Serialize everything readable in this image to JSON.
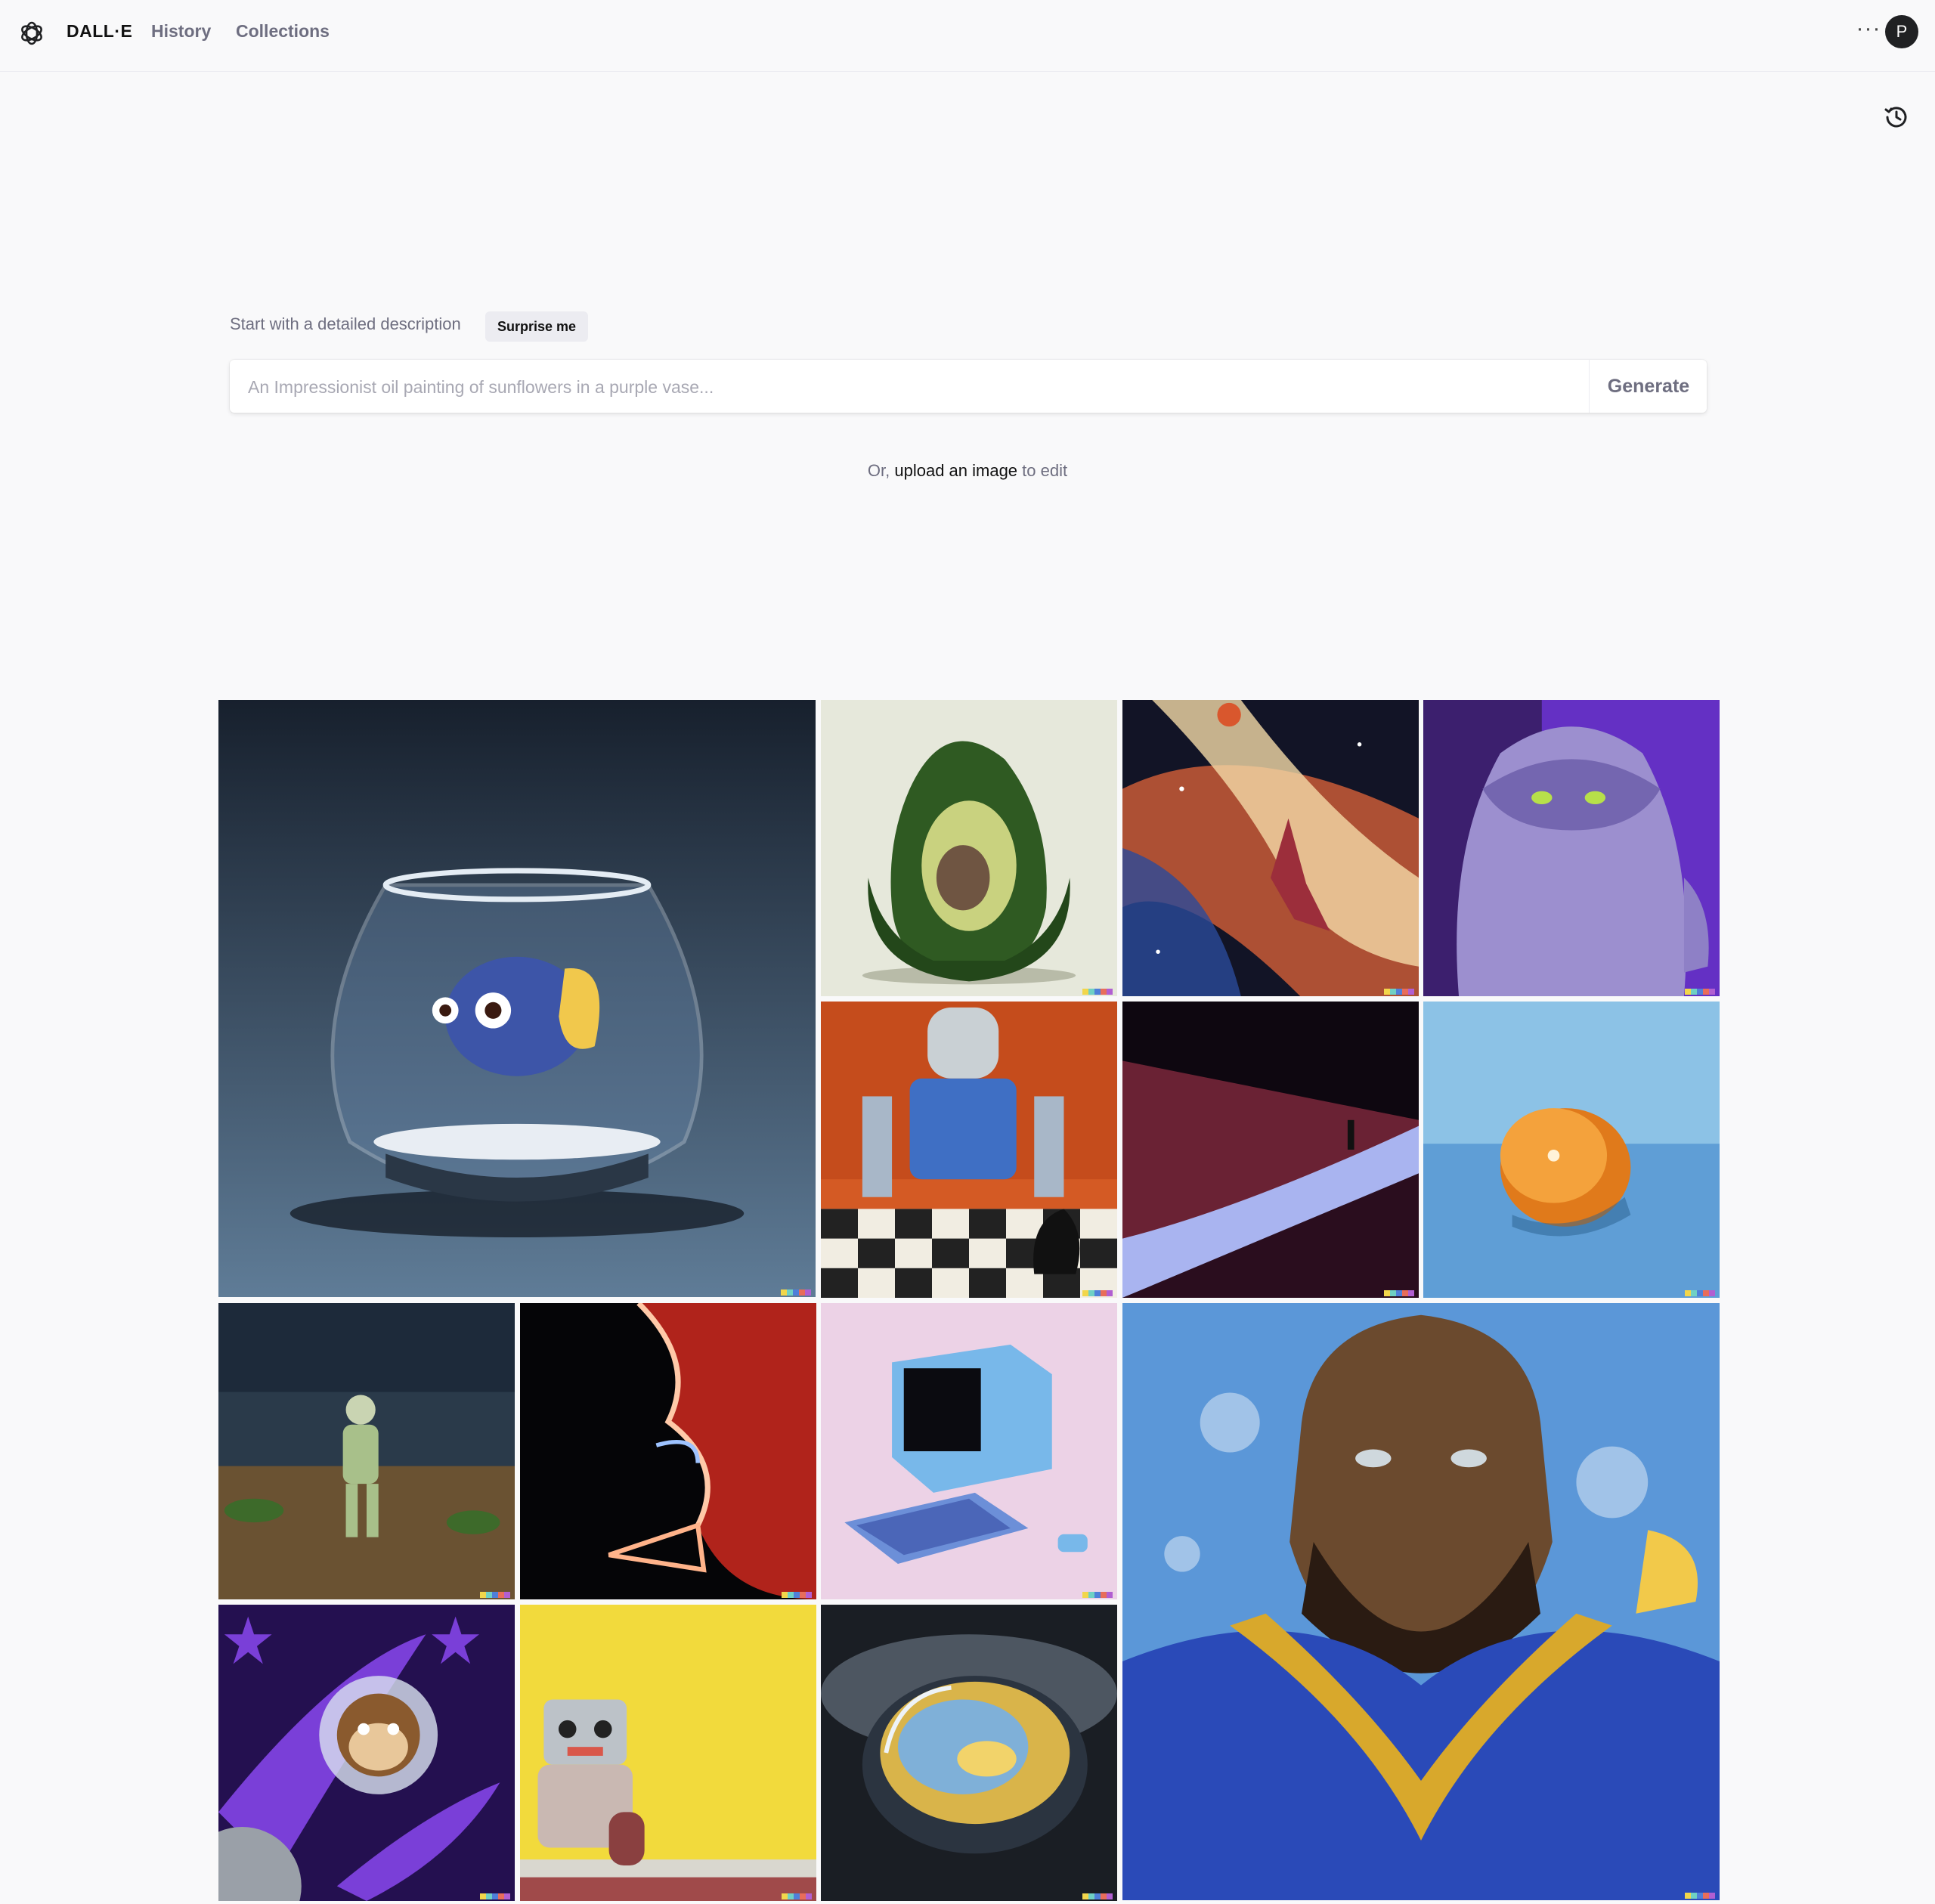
{
  "nav": {
    "brand": "DALL·E",
    "history": "History",
    "collections": "Collections",
    "more": "···",
    "avatar_initial": "P"
  },
  "prompt": {
    "label": "Start with a detailed description",
    "surprise_label": "Surprise me",
    "placeholder": "An Impressionist oil painting of sunflowers in a purple vase...",
    "value": "",
    "generate_label": "Generate"
  },
  "upload": {
    "prefix": "Or,",
    "link": "upload an image",
    "suffix": "to edit"
  },
  "gallery": {
    "tiles": [
      {
        "subject": "fish in a glass fishbowl"
      },
      {
        "subject": "avocado armchair"
      },
      {
        "subject": "basketball player dunking in a nebula"
      },
      {
        "subject": "purple furry monster"
      },
      {
        "subject": "robot playing chess, oil painting"
      },
      {
        "subject": "figure walking on a glowing dune"
      },
      {
        "subject": "orange half on blue surface"
      },
      {
        "subject": "astronaut walking in a desert"
      },
      {
        "subject": "neon nose and lips"
      },
      {
        "subject": "retro pastel computer"
      },
      {
        "subject": "oil painting portrait of a football player"
      },
      {
        "subject": "cartoon monkey astronaut in space"
      },
      {
        "subject": "toy robot against yellow wall"
      },
      {
        "subject": "bowl of soup as a portal to another world"
      }
    ],
    "signature_colors": [
      "#f2d64b",
      "#6fd0c4",
      "#4f7fd9",
      "#e86d5a",
      "#b15fd1"
    ]
  }
}
